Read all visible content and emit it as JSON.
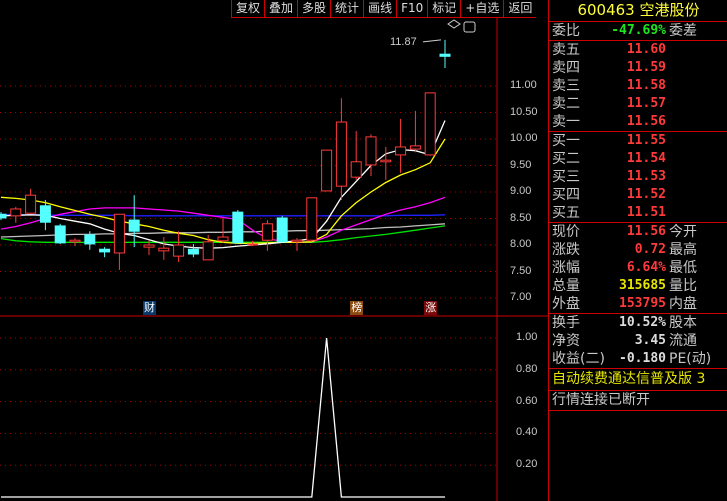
{
  "toolbar": [
    "复权",
    "叠加",
    "多股",
    "统计",
    "画线",
    "F10",
    "标记",
    "+自选",
    "返回"
  ],
  "colors": {
    "up": "#ff3a3a",
    "down": "#54ffff",
    "ma5": "#ffffff",
    "ma10": "#ffff00",
    "ma20": "#ff00ff",
    "ma30": "#2020ff",
    "ma60": "#c0c0c0",
    "ma120": "#00e000"
  },
  "price_axis": [
    "11.00",
    "10.50",
    "10.00",
    "9.50",
    "9.00",
    "8.50",
    "8.00",
    "7.50",
    "7.00"
  ],
  "indicator_axis": [
    "1.00",
    "0.80",
    "0.60",
    "0.40",
    "0.20"
  ],
  "max_label": "11.87",
  "markers": [
    {
      "text": "财",
      "index": 10,
      "color": "#0a3a6a"
    },
    {
      "text": "榜",
      "index": 24,
      "color": "#8a4a10"
    },
    {
      "text": "涨",
      "index": 29,
      "color": "#7a0a0a"
    }
  ],
  "candles": [
    [
      8.58,
      8.62,
      8.47,
      8.51
    ],
    [
      8.55,
      8.72,
      8.42,
      8.68
    ],
    [
      8.6,
      9.06,
      8.6,
      8.94
    ],
    [
      8.74,
      8.85,
      8.28,
      8.43
    ],
    [
      8.36,
      8.4,
      8.02,
      8.04
    ],
    [
      8.06,
      8.13,
      7.98,
      8.09
    ],
    [
      8.19,
      8.26,
      7.91,
      8.02
    ],
    [
      7.92,
      7.96,
      7.77,
      7.87
    ],
    [
      7.85,
      8.58,
      7.53,
      8.58
    ],
    [
      8.47,
      8.94,
      7.96,
      8.26
    ],
    [
      7.96,
      8.08,
      7.81,
      8.0
    ],
    [
      7.89,
      8.15,
      7.72,
      7.94
    ],
    [
      7.79,
      8.26,
      7.68,
      8.0
    ],
    [
      7.92,
      8.02,
      7.77,
      7.83
    ],
    [
      7.72,
      8.19,
      7.72,
      8.06
    ],
    [
      8.08,
      8.51,
      8.04,
      8.15
    ],
    [
      8.62,
      8.66,
      8.04,
      8.04
    ],
    [
      8.0,
      8.08,
      7.98,
      8.02
    ],
    [
      8.09,
      8.47,
      7.89,
      8.4
    ],
    [
      8.51,
      8.55,
      8.06,
      8.06
    ],
    [
      8.06,
      8.13,
      7.89,
      8.09
    ],
    [
      8.09,
      8.89,
      8.06,
      8.89
    ],
    [
      9.02,
      9.79,
      9.02,
      9.79
    ],
    [
      9.11,
      10.77,
      8.85,
      10.32
    ],
    [
      9.28,
      10.15,
      9.23,
      9.57
    ],
    [
      9.51,
      10.09,
      9.3,
      10.04
    ],
    [
      9.57,
      9.85,
      9.23,
      9.6
    ],
    [
      9.7,
      10.38,
      9.36,
      9.85
    ],
    [
      9.81,
      10.53,
      9.75,
      9.87
    ],
    [
      9.7,
      10.87,
      9.7,
      10.87
    ],
    [
      11.6,
      11.87,
      11.34,
      11.56
    ]
  ],
  "ma": {
    "ma5": [
      8.55,
      8.56,
      8.57,
      8.56,
      8.5,
      8.45,
      8.4,
      8.3,
      8.22,
      8.18,
      8.1,
      8.02,
      7.98,
      7.95,
      7.94,
      7.95,
      7.98,
      8.0,
      8.02,
      8.05,
      8.08,
      8.12,
      8.45,
      8.9,
      9.2,
      9.5,
      9.72,
      9.8,
      9.78,
      9.7,
      10.35
    ],
    "ma10": [
      8.9,
      8.88,
      8.85,
      8.8,
      8.72,
      8.65,
      8.58,
      8.52,
      8.45,
      8.4,
      8.35,
      8.28,
      8.22,
      8.18,
      8.1,
      8.05,
      8.03,
      8.03,
      8.04,
      8.05,
      8.05,
      8.06,
      8.2,
      8.55,
      8.8,
      9.0,
      9.18,
      9.32,
      9.42,
      9.55,
      10.0
    ],
    "ma20": [
      8.3,
      8.35,
      8.42,
      8.5,
      8.58,
      8.63,
      8.68,
      8.7,
      8.7,
      8.7,
      8.68,
      8.66,
      8.64,
      8.6,
      8.56,
      8.52,
      8.48,
      8.28,
      8.12,
      8.07,
      8.05,
      8.06,
      8.15,
      8.28,
      8.38,
      8.48,
      8.58,
      8.66,
      8.72,
      8.8,
      8.9
    ],
    "ma30": [
      8.58,
      8.57,
      8.57,
      8.57,
      8.56,
      8.56,
      8.56,
      8.56,
      8.56,
      8.55,
      8.55,
      8.55,
      8.55,
      8.55,
      8.55,
      8.55,
      8.55,
      8.55,
      8.55,
      8.55,
      8.55,
      8.55,
      8.55,
      8.55,
      8.55,
      8.55,
      8.55,
      8.56,
      8.56,
      8.56,
      8.57
    ],
    "ma60": [
      8.15,
      8.16,
      8.17,
      8.18,
      8.19,
      8.2,
      8.2,
      8.21,
      8.21,
      8.22,
      8.22,
      8.23,
      8.23,
      8.23,
      8.24,
      8.24,
      8.25,
      8.25,
      8.26,
      8.26,
      8.27,
      8.27,
      8.28,
      8.29,
      8.3,
      8.31,
      8.33,
      8.34,
      8.36,
      8.38,
      8.4
    ],
    "ma120": [
      8.12,
      8.08,
      8.06,
      8.05,
      8.05,
      8.05,
      8.05,
      8.05,
      8.05,
      8.05,
      8.05,
      8.05,
      8.05,
      8.05,
      8.05,
      8.05,
      8.05,
      8.05,
      8.05,
      8.05,
      8.05,
      8.05,
      8.07,
      8.1,
      8.14,
      8.17,
      8.2,
      8.24,
      8.28,
      8.32,
      8.36
    ]
  },
  "indicator": [
    0,
    0,
    0,
    0,
    0,
    0,
    0,
    0,
    0,
    0,
    0,
    0,
    0,
    0,
    0,
    0,
    0,
    0,
    0,
    0,
    0,
    0,
    1,
    0,
    0,
    0,
    0,
    0,
    0,
    0,
    0
  ],
  "panel": {
    "code": "600463",
    "name": "空港股份",
    "weibi": {
      "label": "委比",
      "value": "-47.69%",
      "right": "委差"
    },
    "asks": [
      {
        "label": "卖五",
        "price": "11.60"
      },
      {
        "label": "卖四",
        "price": "11.59"
      },
      {
        "label": "卖三",
        "price": "11.58"
      },
      {
        "label": "卖二",
        "price": "11.57"
      },
      {
        "label": "卖一",
        "price": "11.56"
      }
    ],
    "bids": [
      {
        "label": "买一",
        "price": "11.55"
      },
      {
        "label": "买二",
        "price": "11.54"
      },
      {
        "label": "买三",
        "price": "11.53"
      },
      {
        "label": "买四",
        "price": "11.52"
      },
      {
        "label": "买五",
        "price": "11.51"
      }
    ],
    "quote": [
      {
        "label": "现价",
        "value": "11.56",
        "right": "今开",
        "c": "red"
      },
      {
        "label": "涨跌",
        "value": "0.72",
        "right": "最高",
        "c": "red"
      },
      {
        "label": "涨幅",
        "value": "6.64%",
        "right": "最低",
        "c": "red"
      },
      {
        "label": "总量",
        "value": "315685",
        "right": "量比",
        "c": "yellow"
      },
      {
        "label": "外盘",
        "value": "153795",
        "right": "内盘",
        "c": "red"
      }
    ],
    "fin": [
      {
        "label": "换手",
        "value": "10.52%",
        "right": "股本"
      },
      {
        "label": "净资",
        "value": "3.45",
        "right": "流通"
      },
      {
        "label": "收益(二)",
        "value": "-0.180",
        "right": "PE(动)"
      }
    ],
    "ad": "自动续费通达信普及版 3",
    "status": "行情连接已断开"
  }
}
